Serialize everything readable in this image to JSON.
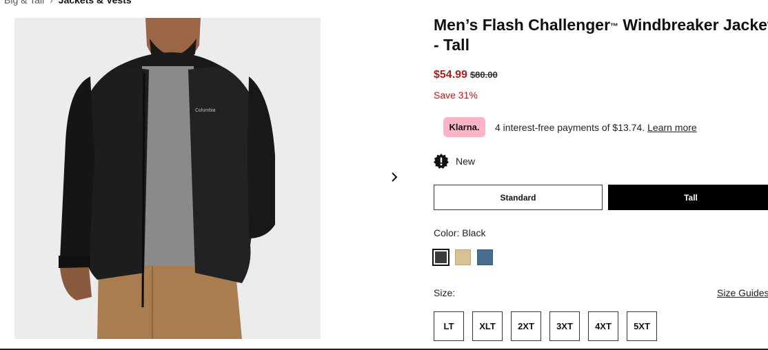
{
  "breadcrumb": {
    "items": [
      "Big & Tall",
      "Jackets & Vests"
    ],
    "separator": "›"
  },
  "product": {
    "title_line1": "Men’s Flash Challenger",
    "trademark": "™",
    "title_line1_end": " Windbreaker Jacket",
    "title_line2": "- Tall",
    "image_alt": "Black Columbia windbreaker jacket on model",
    "brand_mark": "Columbia"
  },
  "price": {
    "sale": "$54.99",
    "original": "$80.00",
    "save": "Save 31%",
    "sale_color": "#b01b1b"
  },
  "klarna": {
    "badge": "Klarna.",
    "text": "4 interest-free payments of $13.74.",
    "link": "Learn more",
    "badge_color": "#ffb3c7"
  },
  "badge_new": {
    "icon": "new-badge-icon",
    "label": "New"
  },
  "fit": {
    "options": [
      "Standard",
      "Tall"
    ],
    "selected": "Tall"
  },
  "color": {
    "label": "Color: Black",
    "swatches": [
      {
        "name": "Black",
        "hex": "#3b3b3e",
        "selected": true
      },
      {
        "name": "Tan",
        "hex": "#d6c294",
        "selected": false
      },
      {
        "name": "Blue",
        "hex": "#4a6d92",
        "selected": false
      }
    ]
  },
  "size": {
    "label": "Size:",
    "guide_link": "Size Guides",
    "options": [
      "LT",
      "XLT",
      "2XT",
      "3XT",
      "4XT",
      "5XT"
    ]
  },
  "gallery": {
    "next_icon": "chevron-right-icon"
  }
}
